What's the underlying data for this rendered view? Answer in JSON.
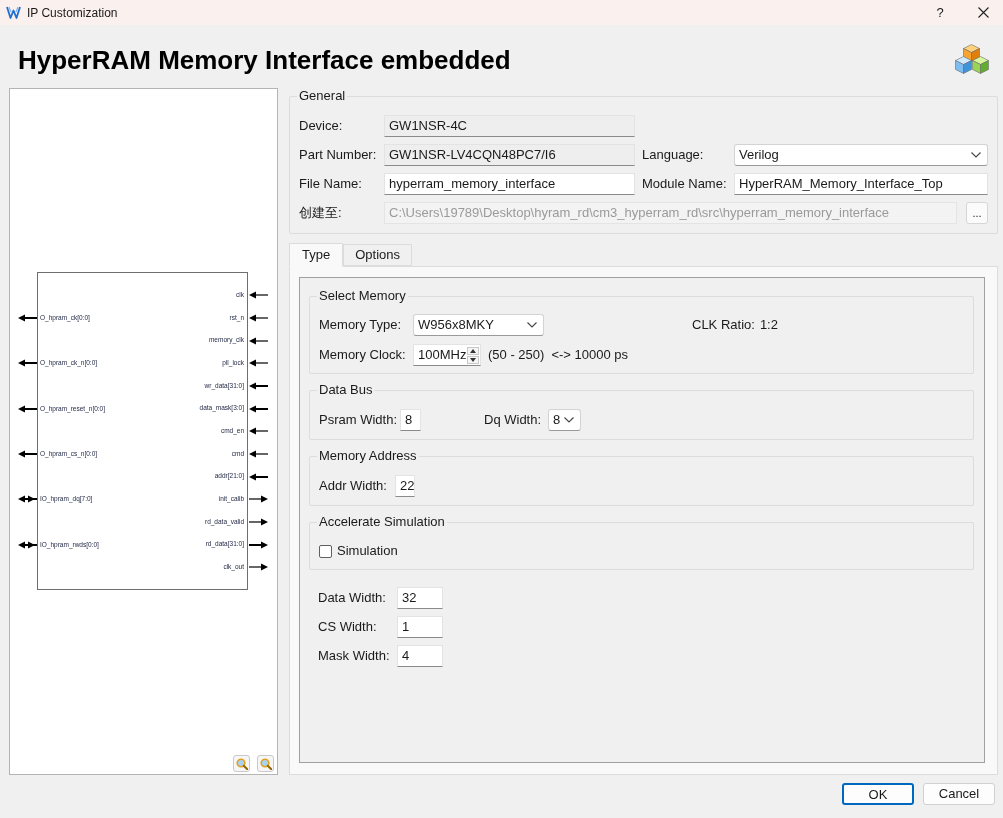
{
  "window": {
    "title": "IP Customization",
    "help": "?"
  },
  "header": {
    "title": "HyperRAM Memory Interface embedded"
  },
  "diagram": {
    "left_pins": [
      {
        "label": "O_hpram_ck[0:0]",
        "kind": "out",
        "bus": true
      },
      {
        "label": "O_hpram_ck_n[0:0]",
        "kind": "out",
        "bus": true
      },
      {
        "label": "O_hpram_reset_n[0:0]",
        "kind": "out",
        "bus": true
      },
      {
        "label": "O_hpram_cs_n[0:0]",
        "kind": "out",
        "bus": true
      },
      {
        "label": "IO_hpram_dq[7:0]",
        "kind": "inout",
        "bus": true
      },
      {
        "label": "IO_hpram_rwds[0:0]",
        "kind": "inout",
        "bus": true
      }
    ],
    "right_pins": [
      {
        "label": "clk",
        "kind": "in",
        "bus": false
      },
      {
        "label": "rst_n",
        "kind": "in",
        "bus": false
      },
      {
        "label": "memory_clk",
        "kind": "in",
        "bus": false
      },
      {
        "label": "pll_lock",
        "kind": "in",
        "bus": false
      },
      {
        "label": "wr_data[31:0]",
        "kind": "in",
        "bus": true
      },
      {
        "label": "data_mask[3:0]",
        "kind": "in",
        "bus": true
      },
      {
        "label": "cmd_en",
        "kind": "in",
        "bus": false
      },
      {
        "label": "cmd",
        "kind": "in",
        "bus": false
      },
      {
        "label": "addr[21:0]",
        "kind": "in",
        "bus": true
      },
      {
        "label": "init_calib",
        "kind": "out",
        "bus": false
      },
      {
        "label": "rd_data_valid",
        "kind": "out",
        "bus": false
      },
      {
        "label": "rd_data[31:0]",
        "kind": "out",
        "bus": true
      },
      {
        "label": "clk_out",
        "kind": "out",
        "bus": false
      }
    ]
  },
  "general": {
    "title": "General",
    "rows": [
      {
        "fields": [
          {
            "label": "Device:",
            "value": "GW1NSR-4C",
            "kind": "readonly"
          }
        ]
      },
      {
        "fields": [
          {
            "label": "Part Number:",
            "value": "GW1NSR-LV4CQN48PC7/I6",
            "kind": "readonly"
          },
          {
            "label": "Language:",
            "value": "Verilog",
            "kind": "dropdown"
          }
        ]
      },
      {
        "fields": [
          {
            "label": "File Name:",
            "value": "hyperram_memory_interface",
            "kind": "text"
          },
          {
            "label": "Module Name:",
            "value": "HyperRAM_Memory_Interface_Top",
            "kind": "text"
          }
        ]
      },
      {
        "fields": [
          {
            "label": "创建至:",
            "value": "C:\\Users\\19789\\Desktop\\hyram_rd\\cm3_hyperram_rd\\src\\hyperram_memory_interface",
            "kind": "path",
            "disabled": true,
            "button": "..."
          }
        ]
      }
    ]
  },
  "tabs": [
    {
      "label": "Type",
      "selected": true
    },
    {
      "label": "Options",
      "selected": false
    }
  ],
  "type_tab": {
    "select_memory": {
      "title": "Select Memory",
      "memory_type": {
        "label": "Memory Type:",
        "value": "W956x8MKY"
      },
      "clk_ratio": {
        "label": "CLK Ratio:",
        "value": "1:2"
      },
      "memory_clock": {
        "label": "Memory Clock:",
        "value": "100MHz",
        "range": "(50 - 250)",
        "period": "<-> 10000 ps"
      }
    },
    "data_bus": {
      "title": "Data Bus",
      "psram_width": {
        "label": "Psram Width:",
        "value": "8"
      },
      "dq_width": {
        "label": "Dq Width:",
        "value": "8"
      }
    },
    "memory_address": {
      "title": "Memory Address",
      "addr_width": {
        "label": "Addr Width:",
        "value": "22"
      }
    },
    "accelerate_simulation": {
      "title": "Accelerate Simulation",
      "simulation": {
        "label": "Simulation",
        "checked": false
      }
    },
    "widths": [
      {
        "label": "Data Width:",
        "value": "32"
      },
      {
        "label": "CS Width:",
        "value": "1"
      },
      {
        "label": "Mask Width:",
        "value": "4"
      }
    ]
  },
  "buttons": [
    {
      "label": "OK",
      "default": true
    },
    {
      "label": "Cancel",
      "default": false
    }
  ]
}
